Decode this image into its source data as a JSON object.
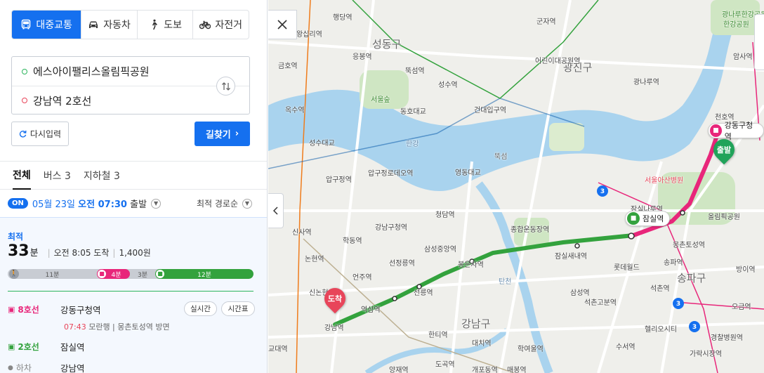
{
  "modes": [
    {
      "label": "대중교통",
      "icon": "bus-icon",
      "active": true
    },
    {
      "label": "자동차",
      "icon": "car-icon",
      "active": false
    },
    {
      "label": "도보",
      "icon": "walk-icon",
      "active": false
    },
    {
      "label": "자전거",
      "icon": "bicycle-icon",
      "active": false
    }
  ],
  "route_input": {
    "origin": "에스아이팰리스올림픽공원",
    "destination": "강남역 2호선"
  },
  "buttons": {
    "reset": "다시입력",
    "search": "길찾기"
  },
  "tabs": [
    "전체",
    "버스 3",
    "지하철 3"
  ],
  "departure": {
    "badge": "ON",
    "date": "05월 23일",
    "time": "오전 07:30",
    "suffix": "출발",
    "sort": "최적 경로순"
  },
  "result": {
    "tag": "최적",
    "duration_num": "33",
    "duration_unit": "분",
    "arrival": "오전 8:05 도착",
    "fare": "1,400원",
    "segments": [
      {
        "type": "walk",
        "label": "11분",
        "minutes": 11,
        "color": "#c8ccd3"
      },
      {
        "type": "line8",
        "label": "4분",
        "minutes": 4,
        "color": "#e8267a"
      },
      {
        "type": "transfer",
        "label": "3분",
        "minutes": 3,
        "color": "#c8ccd3"
      },
      {
        "type": "line2",
        "label": "12분",
        "minutes": 12,
        "color": "#33a23d"
      }
    ],
    "steps": [
      {
        "line": "8호선",
        "station": "강동구청역",
        "color": "#e8267a"
      },
      {
        "line": "2호선",
        "station": "잠실역",
        "color": "#33a23d"
      },
      {
        "line": "하차",
        "station": "강남역",
        "color": "#888888"
      }
    ],
    "step1_time": "07:43",
    "step1_detail": "모란행 | 몽촌토성역 방면",
    "pills": [
      "실시간",
      "시간표"
    ]
  },
  "map": {
    "districts": [
      "성동구",
      "광진구",
      "송파구",
      "강남구"
    ],
    "markers": {
      "start": "출발",
      "end": "도착"
    },
    "station_tags": [
      "강동구청역",
      "잠실역"
    ],
    "labels": [
      "행당역",
      "왕십리역",
      "금호역",
      "응봉역",
      "뚝섬역",
      "성수역",
      "건대입구역",
      "군자역",
      "어린이대공원역",
      "옥수역",
      "압구정역",
      "압구정로데오역",
      "영동대교",
      "청담역",
      "강남구청역",
      "선정릉역",
      "선릉역",
      "역삼역",
      "강남역",
      "신사역",
      "학동역",
      "논현역",
      "신논현역",
      "언주역",
      "한티역",
      "도곡역",
      "대치역",
      "학여울역",
      "삼성역",
      "봉은사역",
      "종합운동장역",
      "잠실새내역",
      "석촌역",
      "송파역",
      "천호역",
      "광나루역",
      "암사역",
      "올림픽공원",
      "롯데월드",
      "서울아산병원",
      "한강",
      "서울숲",
      "성수대교",
      "동호대교",
      "뚝섬",
      "탄천",
      "잠실나루역",
      "방이역",
      "오금역",
      "가락시장역",
      "수서역",
      "개포동역",
      "매봉역",
      "양재역",
      "교대역",
      "삼성중앙역",
      "몽촌토성역",
      "석촌고분역",
      "헬리오시티",
      "경찰병원역",
      "한강공원",
      "광나루한강공원"
    ]
  }
}
